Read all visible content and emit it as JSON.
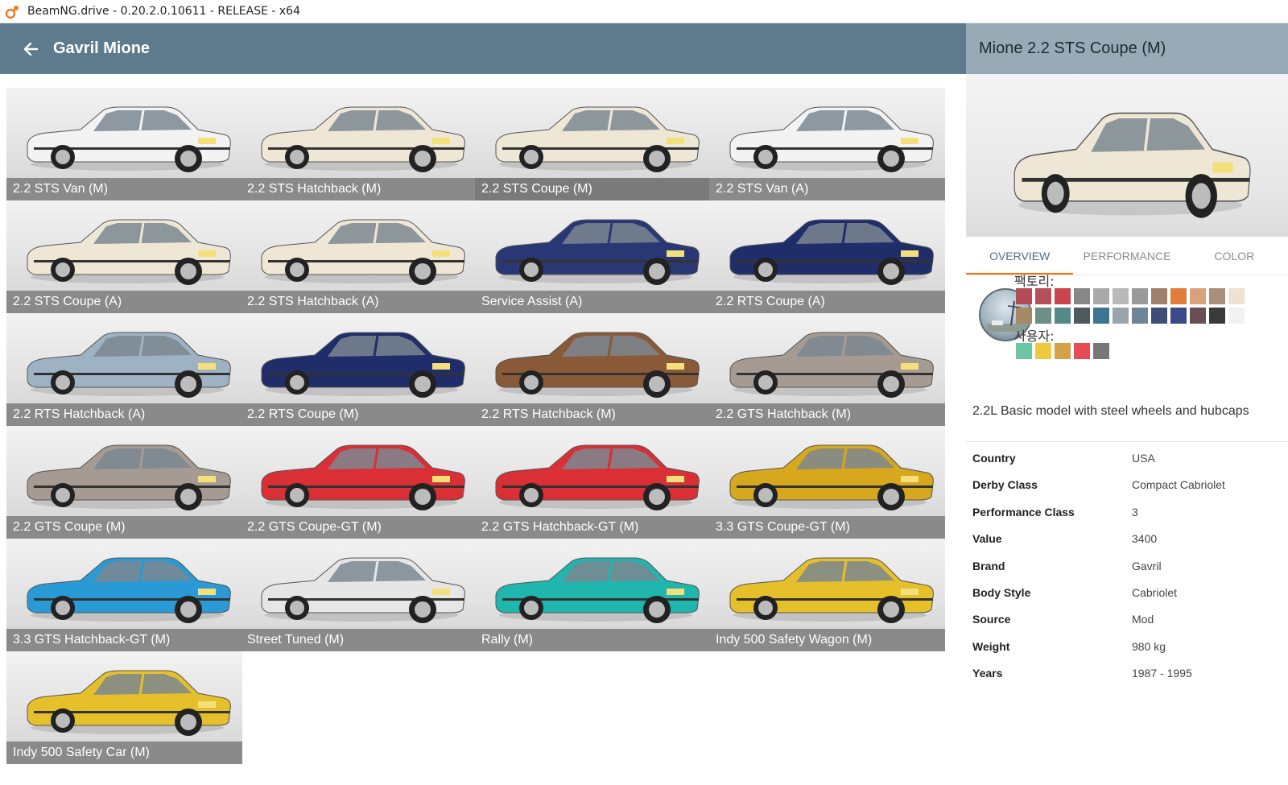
{
  "window": {
    "title": "BeamNG.drive - 0.20.2.0.10611 - RELEASE - x64"
  },
  "header": {
    "model_name": "Gavril Mione"
  },
  "configs": [
    {
      "label": "2.2 STS Van (M)",
      "color": "#f3f3f3"
    },
    {
      "label": "2.2 STS Hatchback (M)",
      "color": "#efe7d6"
    },
    {
      "label": "2.2 STS Coupe (M)",
      "color": "#efe7d6"
    },
    {
      "label": "2.2 STS Van (A)",
      "color": "#f3f3f3"
    },
    {
      "label": "2.2 STS Coupe (A)",
      "color": "#efe7d6"
    },
    {
      "label": "2.2 STS Hatchback (A)",
      "color": "#efe7d6"
    },
    {
      "label": "Service Assist (A)",
      "color": "#2a3775"
    },
    {
      "label": "2.2 RTS Coupe (A)",
      "color": "#1f2d6b"
    },
    {
      "label": "2.2 RTS Hatchback (A)",
      "color": "#9fb2c3"
    },
    {
      "label": "2.2 RTS Coupe (M)",
      "color": "#1f2d6b"
    },
    {
      "label": "2.2 RTS Hatchback (M)",
      "color": "#8a5a38"
    },
    {
      "label": "2.2 GTS Hatchback (M)",
      "color": "#a59b93"
    },
    {
      "label": "2.2 GTS Coupe (M)",
      "color": "#a59b93"
    },
    {
      "label": "2.2 GTS Coupe-GT (M)",
      "color": "#d92f35"
    },
    {
      "label": "2.2 GTS Hatchback-GT (M)",
      "color": "#d92f35"
    },
    {
      "label": "3.3 GTS Coupe-GT (M)",
      "color": "#d7a81d"
    },
    {
      "label": "3.3 GTS Hatchback-GT (M)",
      "color": "#2a9ad6"
    },
    {
      "label": "Street Tuned (M)",
      "color": "#e6e6e6"
    },
    {
      "label": "Rally (M)",
      "color": "#1fb7ad"
    },
    {
      "label": "Indy 500 Safety Wagon (M)",
      "color": "#e6c02a"
    },
    {
      "label": "Indy 500 Safety Car (M)",
      "color": "#e6c02a"
    }
  ],
  "details": {
    "title": "Mione 2.2 STS Coupe (M)",
    "preview_color": "#efe7d6",
    "tabs": [
      "OVERVIEW",
      "PERFORMANCE",
      "COLOR"
    ],
    "factory_label": "팩토리:",
    "user_label": "사용자:",
    "factory_colors": [
      "#b34c55",
      "#b54f5a",
      "#c9454d",
      "#878787",
      "#a9a9a9",
      "#b9b9b9",
      "#9a9a9a",
      "#a0806d",
      "#e17d3a",
      "#d9a27c",
      "#a78f79",
      "#efe2d2",
      "#a68a66",
      "#6e8f86",
      "#54898a",
      "#4d5a62",
      "#3c7593",
      "#9aa4ad",
      "#6f8597",
      "#3d4e77",
      "#3b4b8a",
      "#6a4e56",
      "#3b3b3b",
      "#f2f2f2"
    ],
    "user_colors": [
      "#6dc6a6",
      "#efc83e",
      "#d4a04a",
      "#e54c54",
      "#777777"
    ],
    "description": "2.2L Basic model with steel wheels and hubcaps",
    "specs": [
      {
        "key": "Country",
        "value": "USA"
      },
      {
        "key": "Derby Class",
        "value": "Compact Cabriolet"
      },
      {
        "key": "Performance Class",
        "value": "3"
      },
      {
        "key": "Value",
        "value": "3400"
      },
      {
        "key": "Brand",
        "value": "Gavril"
      },
      {
        "key": "Body Style",
        "value": "Cabriolet"
      },
      {
        "key": "Source",
        "value": "Mod"
      },
      {
        "key": "Weight",
        "value": "980 kg"
      },
      {
        "key": "Years",
        "value": "1987 - 1995"
      }
    ]
  }
}
